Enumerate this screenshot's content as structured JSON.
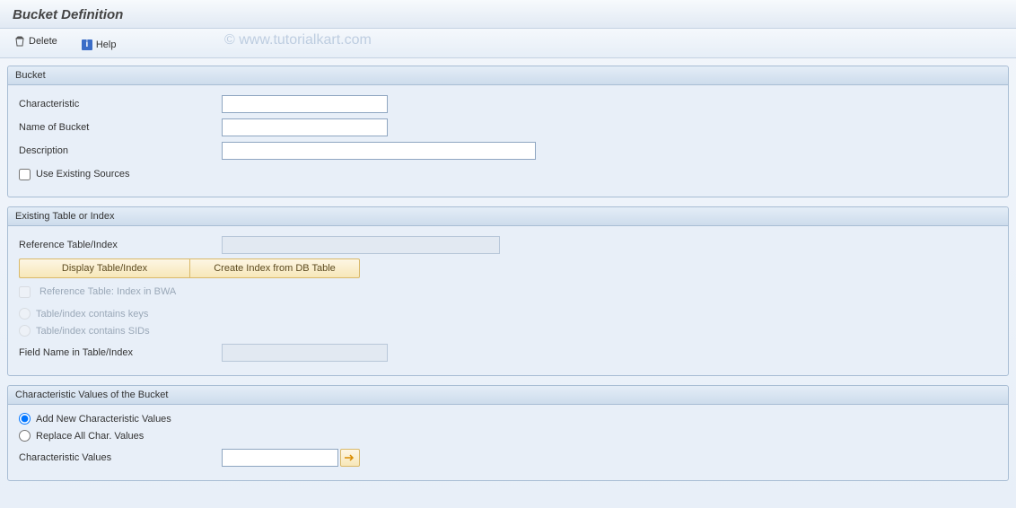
{
  "page": {
    "title": "Bucket Definition",
    "watermark": "© www.tutorialkart.com"
  },
  "toolbar": {
    "delete_label": "Delete",
    "help_label": "Help"
  },
  "bucket": {
    "legend": "Bucket",
    "characteristic_label": "Characteristic",
    "characteristic_value": "",
    "name_label": "Name of Bucket",
    "name_value": "",
    "description_label": "Description",
    "description_value": "",
    "use_existing_label": "Use Existing Sources",
    "use_existing_checked": false
  },
  "existing": {
    "legend": "Existing Table or Index",
    "ref_label": "Reference Table/Index",
    "ref_value": "",
    "display_btn": "Display Table/Index",
    "create_btn": "Create Index from DB Table",
    "ref_bwa_label": "Reference Table: Index in BWA",
    "contains_keys_label": "Table/index contains keys",
    "contains_sids_label": "Table/index contains SIDs",
    "field_label": "Field Name in Table/Index",
    "field_value": ""
  },
  "charvals": {
    "legend": "Characteristic Values of the Bucket",
    "add_new_label": "Add New Characteristic Values",
    "replace_label": "Replace All Char. Values",
    "values_label": "Characteristic Values",
    "values_value": ""
  }
}
